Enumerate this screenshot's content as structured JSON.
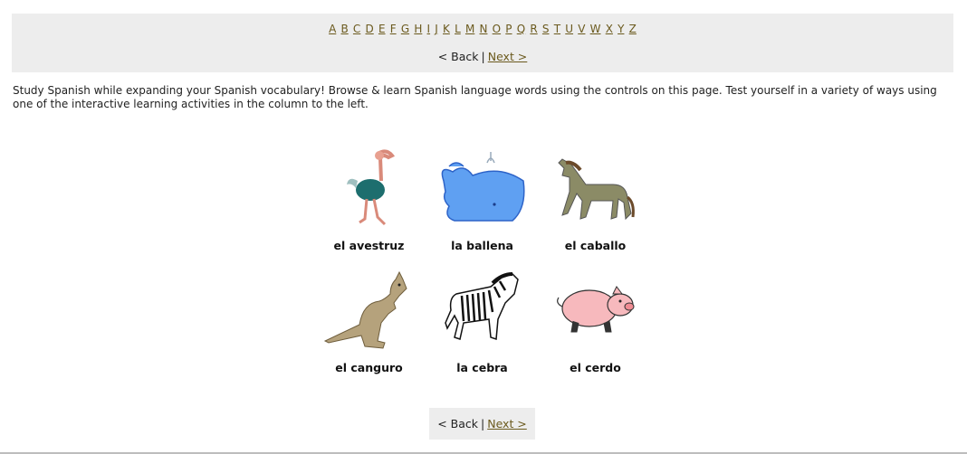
{
  "alphabet": [
    "A",
    "B",
    "C",
    "D",
    "E",
    "F",
    "G",
    "H",
    "I",
    "J",
    "K",
    "L",
    "M",
    "N",
    "O",
    "P",
    "Q",
    "R",
    "S",
    "T",
    "U",
    "V",
    "W",
    "X",
    "Y",
    "Z"
  ],
  "nav": {
    "back_label": "< Back",
    "separator": "|",
    "next_label": "Next >"
  },
  "intro_text": "Study Spanish while expanding your Spanish vocabulary! Browse & learn Spanish language words using the controls on this page. Test yourself in a variety of ways using one of the interactive learning activities in the column to the left.",
  "words": [
    {
      "word": "el avestruz",
      "icon": "ostrich-icon"
    },
    {
      "word": "la ballena",
      "icon": "whale-icon"
    },
    {
      "word": "el caballo",
      "icon": "horse-icon"
    },
    {
      "word": "el canguro",
      "icon": "kangaroo-icon"
    },
    {
      "word": "la cebra",
      "icon": "zebra-icon"
    },
    {
      "word": "el cerdo",
      "icon": "pig-icon"
    }
  ],
  "colors": {
    "bar_background": "#ededed",
    "link_color": "#6b5a1e"
  }
}
